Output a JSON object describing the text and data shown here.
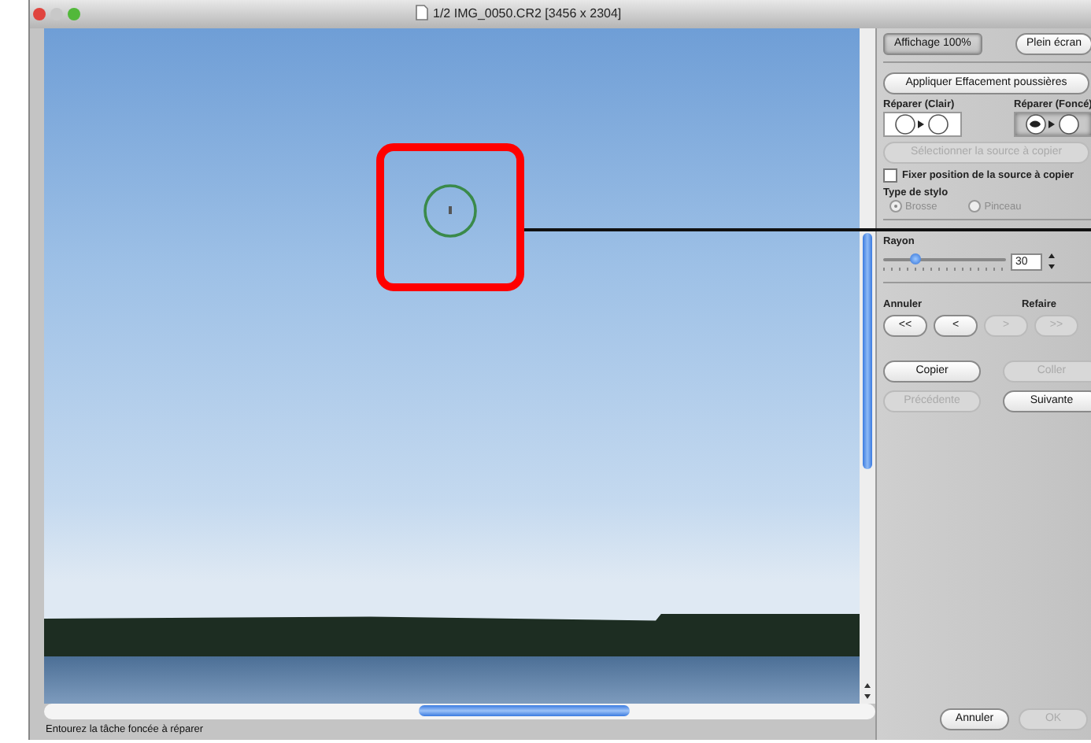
{
  "window": {
    "title": "1/2 IMG_0050.CR2 [3456 x 2304]"
  },
  "view_buttons": [
    {
      "label": "Affichage 100%",
      "selected": true
    },
    {
      "label": "Plein écran",
      "selected": false
    }
  ],
  "apply_button": {
    "label": "Appliquer Effacement poussières",
    "disabled": false
  },
  "repair_tools": [
    {
      "label": "Réparer (Clair)",
      "selected": false
    },
    {
      "label": "Réparer (Foncé)",
      "selected": true
    }
  ],
  "select_source_button": {
    "label": "Sélectionner la source à copier",
    "disabled": true
  },
  "fix_source": {
    "label": "Fixer position de la source à copier",
    "checked": false
  },
  "pen_type": {
    "label": "Type de stylo",
    "options": [
      {
        "label": "Brosse",
        "selected": true,
        "disabled": true
      },
      {
        "label": "Pinceau",
        "selected": false,
        "disabled": true
      }
    ]
  },
  "radius": {
    "label": "Rayon",
    "level": 0.25,
    "value": "30"
  },
  "history": {
    "undo_label": "Annuler",
    "redo_label": "Refaire",
    "buttons": [
      {
        "label": "<<",
        "disabled": false
      },
      {
        "label": "<",
        "disabled": false
      },
      {
        "label": ">",
        "disabled": true
      },
      {
        "label": ">>",
        "disabled": true
      }
    ]
  },
  "edit_buttons": [
    {
      "label": "Copier",
      "disabled": false
    },
    {
      "label": "Coller",
      "disabled": true
    },
    {
      "label": "Précédente",
      "disabled": true
    },
    {
      "label": "Suivante",
      "disabled": false
    }
  ],
  "dialog_buttons": [
    {
      "label": "Annuler",
      "disabled": false
    },
    {
      "label": "OK",
      "disabled": true
    }
  ],
  "status_bar": {
    "text": "Entourez la tâche foncée à réparer"
  }
}
